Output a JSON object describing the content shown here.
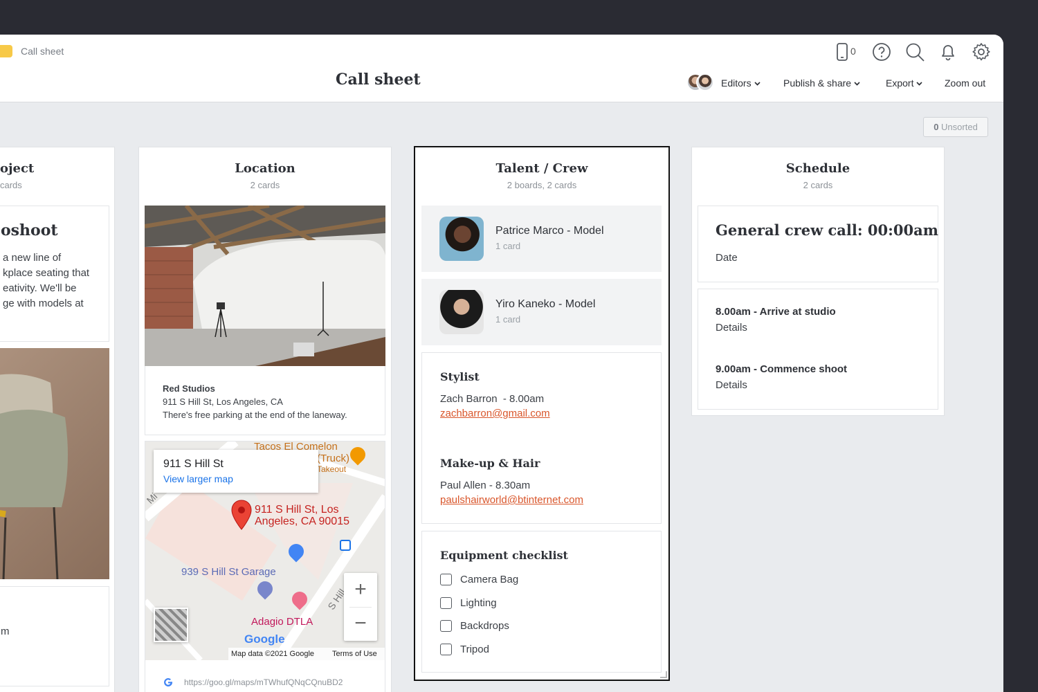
{
  "header": {
    "breadcrumb": "Call sheet",
    "title": "Call sheet",
    "device_count": "0",
    "menus": {
      "editors": "Editors",
      "publish": "Publish & share",
      "export": "Export",
      "zoom": "Zoom out"
    },
    "icons": [
      "phone-icon",
      "help-icon",
      "search-icon",
      "bell-icon",
      "gear-icon"
    ]
  },
  "unsorted": {
    "count": "0",
    "label": "Unsorted"
  },
  "columns": {
    "project": {
      "title": "Project",
      "title_visible": "oject",
      "sub_visible": "cards",
      "card_title_visible": "oshoot",
      "card_lines": [
        "a new line of",
        "kplace seating that",
        "eativity. We'll be",
        "ge with models at"
      ],
      "bottom_text": "m"
    },
    "location": {
      "title": "Location",
      "sub": "2 cards",
      "venue": "Red Studios",
      "address": "911 S Hill St, Los Angeles, CA",
      "note": "There's free parking at the end of the laneway.",
      "map": {
        "place": "911 S Hill St",
        "larger_map": "View larger map",
        "pin_label_1": "911 S Hill St, Los",
        "pin_label_2": "Angeles, CA 90015",
        "poi_taco_1": "Tacos El Comelon",
        "poi_taco_2": "(Truck)",
        "poi_taco_3": "Takeout",
        "garage": "939 S Hill St Garage",
        "adagio": "Adagio DTLA",
        "street": "S Hill",
        "street_mid": "Mi",
        "google": "Google",
        "map_data": "Map data ©2021 Google",
        "terms": "Terms of Use",
        "url": "https://goo.gl/maps/mTWhufQNqCQnuBD2",
        "zoom_in": "+",
        "zoom_out": "−"
      }
    },
    "talent": {
      "title": "Talent / Crew",
      "sub": "2 boards, 2 cards",
      "boards": [
        {
          "name": "Patrice Marco - Model",
          "sub": "1 card"
        },
        {
          "name": "Yiro Kaneko - Model",
          "sub": "1 card"
        }
      ],
      "stylist": {
        "heading": "Stylist",
        "line": "Zach Barron  - 8.00am",
        "email": "zachbarron@gmail.com"
      },
      "makeup": {
        "heading": "Make-up & Hair",
        "line": "Paul Allen - 8.30am",
        "email": "paulshairworld@btinternet.com"
      },
      "checklist": {
        "heading": "Equipment checklist",
        "items": [
          "Camera Bag",
          "Lighting",
          "Backdrops",
          "Tripod"
        ]
      }
    },
    "schedule": {
      "title": "Schedule",
      "sub": "2 cards",
      "crew_call": "General crew call: 00:00am",
      "date": "Date",
      "items": [
        {
          "time": "8.00am - Arrive at studio",
          "details": "Details"
        },
        {
          "time": "9.00am - Commence shoot",
          "details": "Details"
        }
      ]
    }
  },
  "colors": {
    "accent_yellow": "#f7c948",
    "link": "#d9562b",
    "map_red": "#d93025",
    "map_blue": "#1a73e8"
  }
}
